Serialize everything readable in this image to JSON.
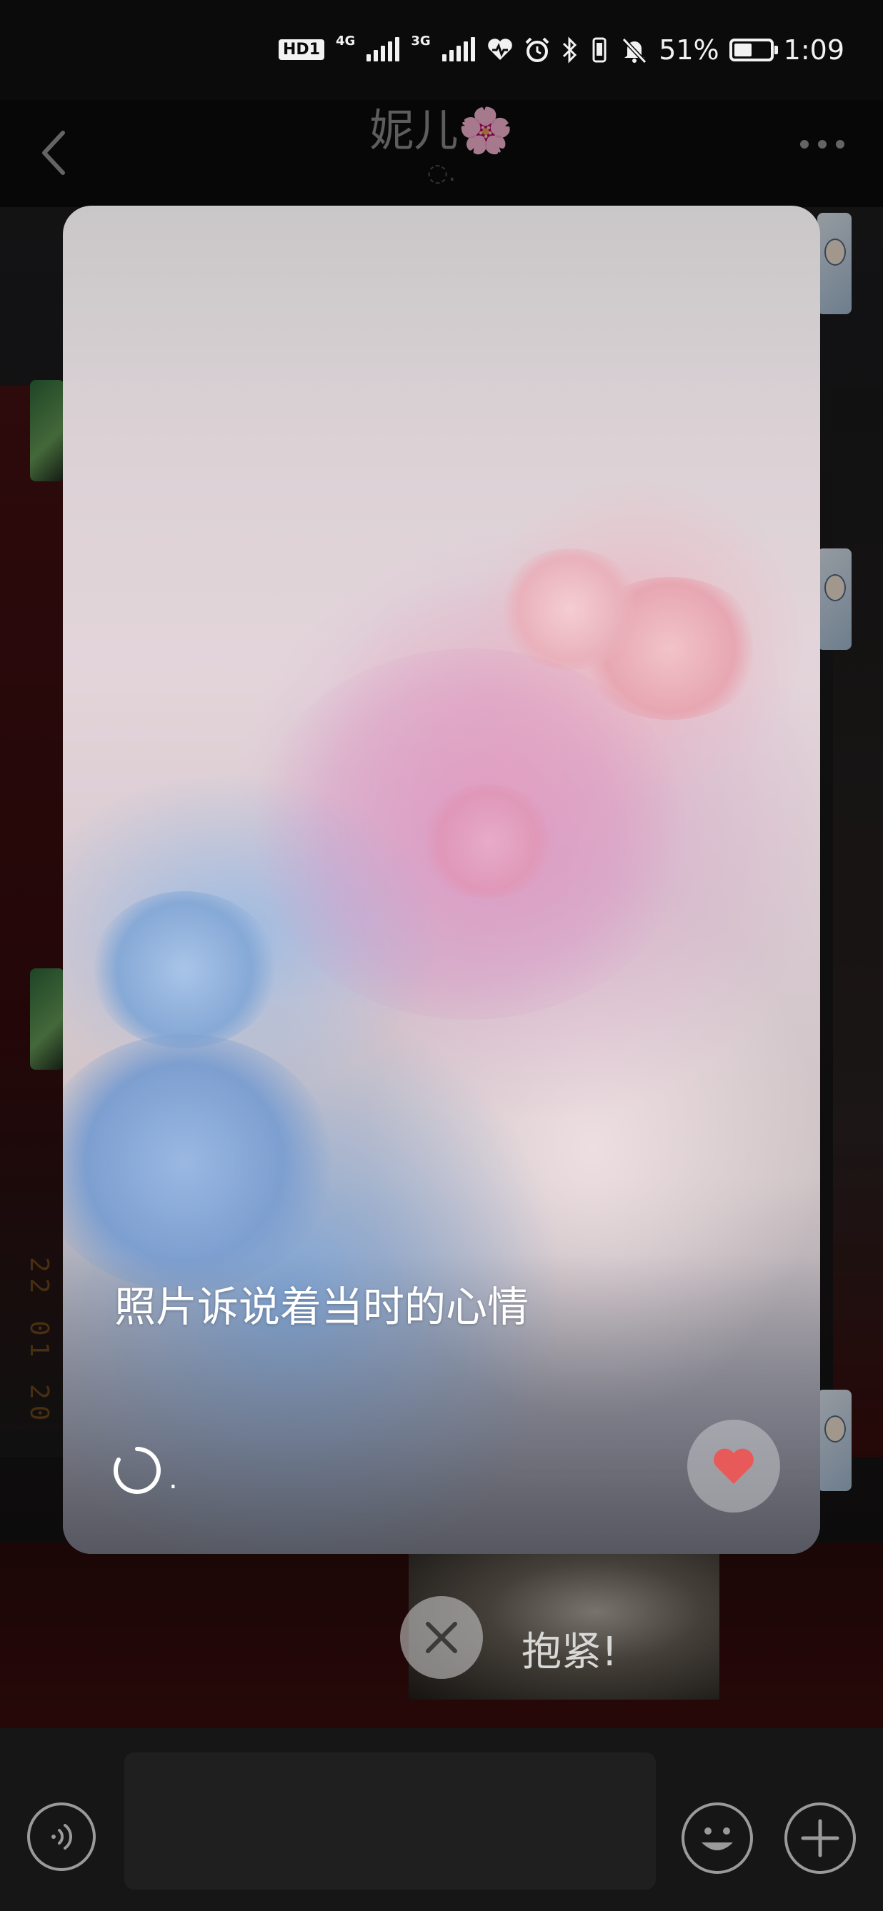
{
  "status_bar": {
    "hd_badge": "HD",
    "sim1_badge": "1",
    "network1": "4G",
    "network2": "3G",
    "battery_percent_text": "51%",
    "battery_level": 0.51,
    "time": "1:09"
  },
  "nav": {
    "title": "妮儿🌸",
    "status": "◌."
  },
  "card": {
    "caption": "照片诉说着当时的心情",
    "loading_dot": ".",
    "like_color": "#e85a5a"
  },
  "bottom": {
    "caption": "抱紧!"
  },
  "input": {
    "value": ""
  },
  "colors": {
    "background": "#0b0b0c",
    "icon_gray": "#9a9a9a"
  },
  "background_stamp": "22 01 20"
}
